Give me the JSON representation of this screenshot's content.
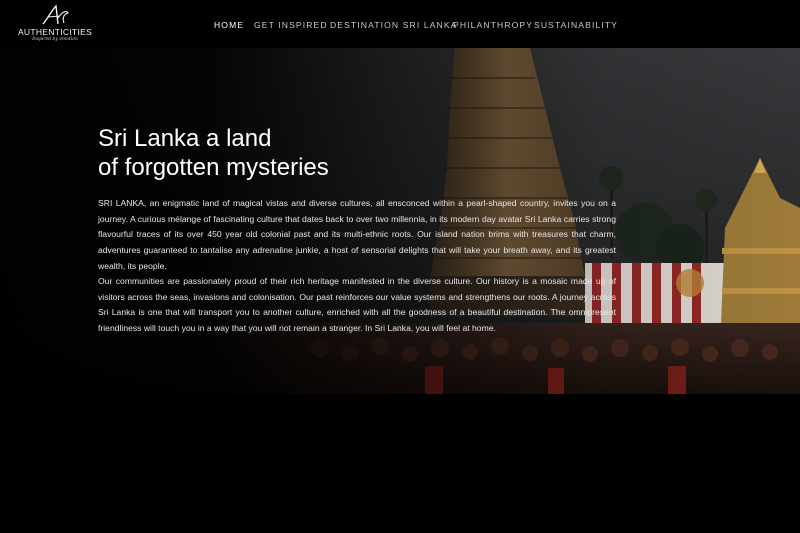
{
  "brand": {
    "mark": "A",
    "name": "AUTHENTICITIES",
    "tagline": "Inspired by emotion"
  },
  "nav": {
    "items": [
      {
        "label": "HOME",
        "active": true
      },
      {
        "label": "GET INSPIRED",
        "active": false
      },
      {
        "label": "DESTINATION SRI LANKA",
        "active": false
      },
      {
        "label": "PHILANTHROPY",
        "active": false
      },
      {
        "label": "SUSTAINABILITY",
        "active": false
      }
    ]
  },
  "hero": {
    "title_line1": "Sri Lanka a land",
    "title_line2": "of forgotten mysteries",
    "paragraph1": "SRI LANKA, an enigmatic land of magical vistas and diverse cultures, all ensconced within a pearl-shaped country, invites you on a journey. A curious mélange of fascinating culture that dates back to over two millennia, in its modern day avatar Sri Lanka carries strong flavourful traces of its over 450 year old colonial past and its multi-ethnic roots. Our island nation brims with treasures that charm, adventures guaranteed to tantalise any adrenaline junkie, a host of sensorial delights that will take your breath away, and its greatest wealth, its people.",
    "paragraph2": "Our communities are passionately proud of their rich heritage manifested in the diverse culture. Our history is a mosaic made up of visitors across the seas, invasions and colonisation. Our past reinforces our value systems and strengthens our roots. A journey across Sri Lanka is one that will transport you to another culture, enriched with all the goodness of a beautiful destination. The omnipresent friendliness will touch you in a way that you will not remain a stranger. In Sri Lanka, you will feel at home."
  },
  "colors": {
    "background": "#000000",
    "nav_text": "#c9c9c9",
    "nav_active": "#ffffff",
    "body_text": "#e6e6e6"
  }
}
